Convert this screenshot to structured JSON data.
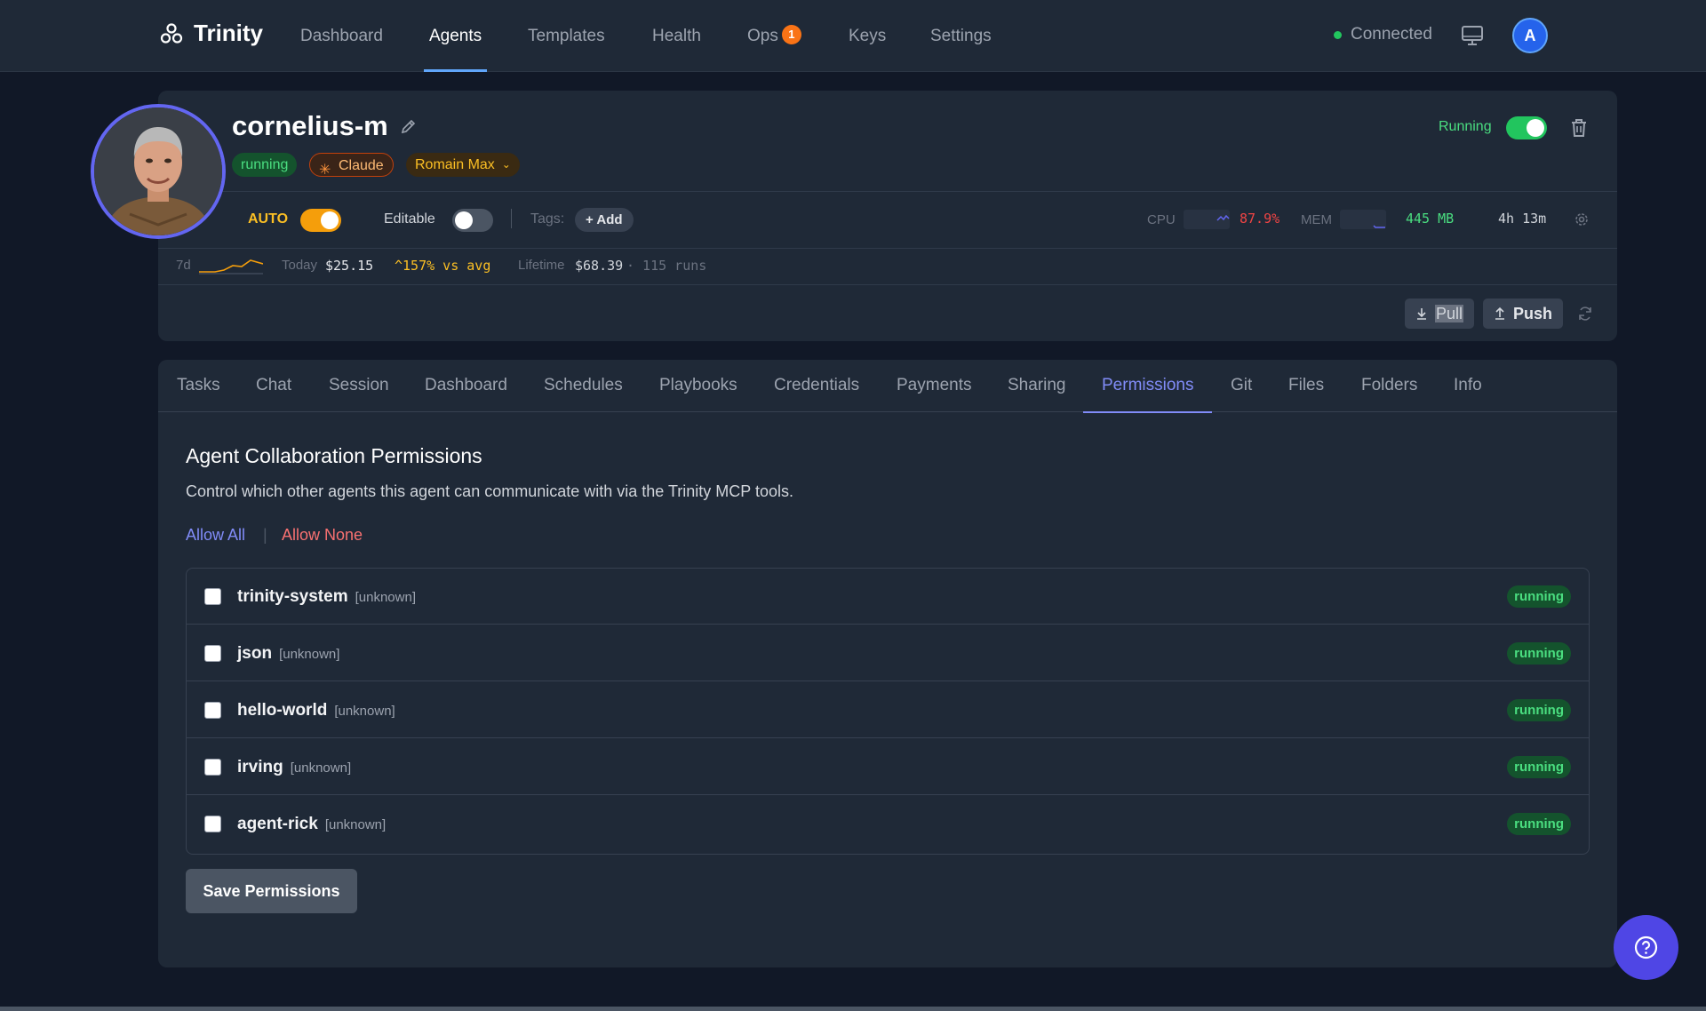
{
  "nav": {
    "brand": "Trinity",
    "items": [
      {
        "label": "Dashboard"
      },
      {
        "label": "Agents"
      },
      {
        "label": "Templates"
      },
      {
        "label": "Health"
      },
      {
        "label": "Ops",
        "badge": "1"
      },
      {
        "label": "Keys"
      },
      {
        "label": "Settings"
      }
    ],
    "active": "Agents",
    "status": "Connected",
    "user_initial": "A"
  },
  "agent": {
    "name": "cornelius-m",
    "status_badge": "running",
    "provider": "Claude",
    "model": "Romain Max",
    "run_state": "Running",
    "auto_label": "AUTO",
    "auto_on": true,
    "editable_label": "Editable",
    "editable_on": false,
    "tags_label": "Tags:",
    "add_tag": "Add",
    "cpu_label": "CPU",
    "cpu_value": "87.9%",
    "mem_label": "MEM",
    "mem_value": "445 MB",
    "uptime": "4h 13m"
  },
  "cost": {
    "period": "7d",
    "today_label": "Today",
    "today_value": "$25.15",
    "trend": "157% vs avg",
    "lifetime_label": "Lifetime",
    "lifetime_value": "$68.39",
    "runs": "· 115 runs"
  },
  "actions": {
    "pull": "Pull",
    "push": "Push"
  },
  "tabs": [
    "Tasks",
    "Chat",
    "Session",
    "Dashboard",
    "Schedules",
    "Playbooks",
    "Credentials",
    "Payments",
    "Sharing",
    "Permissions",
    "Git",
    "Files",
    "Folders",
    "Info"
  ],
  "active_tab": "Permissions",
  "permissions": {
    "title": "Agent Collaboration Permissions",
    "description": "Control which other agents this agent can communicate with via the Trinity MCP tools.",
    "allow_all": "Allow All",
    "separator": "|",
    "allow_none": "Allow None",
    "agents": [
      {
        "name": "trinity-system",
        "type": "[unknown]",
        "status": "running",
        "checked": false
      },
      {
        "name": "json",
        "type": "[unknown]",
        "status": "running",
        "checked": false
      },
      {
        "name": "hello-world",
        "type": "[unknown]",
        "status": "running",
        "checked": false
      },
      {
        "name": "irving",
        "type": "[unknown]",
        "status": "running",
        "checked": false
      },
      {
        "name": "agent-rick",
        "type": "[unknown]",
        "status": "running",
        "checked": false
      }
    ],
    "save_label": "Save Permissions"
  },
  "colors": {
    "accent": "#818cf8",
    "running": "#4ade80",
    "danger": "#f87171",
    "amber": "#fbbf24"
  }
}
